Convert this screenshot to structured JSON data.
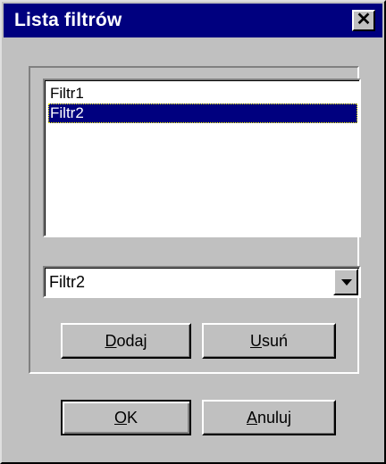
{
  "window": {
    "title": "Lista filtrów",
    "close_glyph": "✕"
  },
  "filters": {
    "list_items": [
      "Filtr1",
      "Filtr2"
    ],
    "selected_index": 1,
    "combo_value": "Filtr2"
  },
  "buttons": {
    "add": {
      "accel": "D",
      "rest": "odaj"
    },
    "remove": {
      "accel": "U",
      "rest": "suń"
    },
    "ok": {
      "accel": "O",
      "rest": "K"
    },
    "cancel": {
      "accel": "A",
      "rest": "nuluj"
    }
  },
  "colors": {
    "face": "#c0c0c0",
    "titlebar": "#00007f",
    "selection": "#00007f"
  }
}
